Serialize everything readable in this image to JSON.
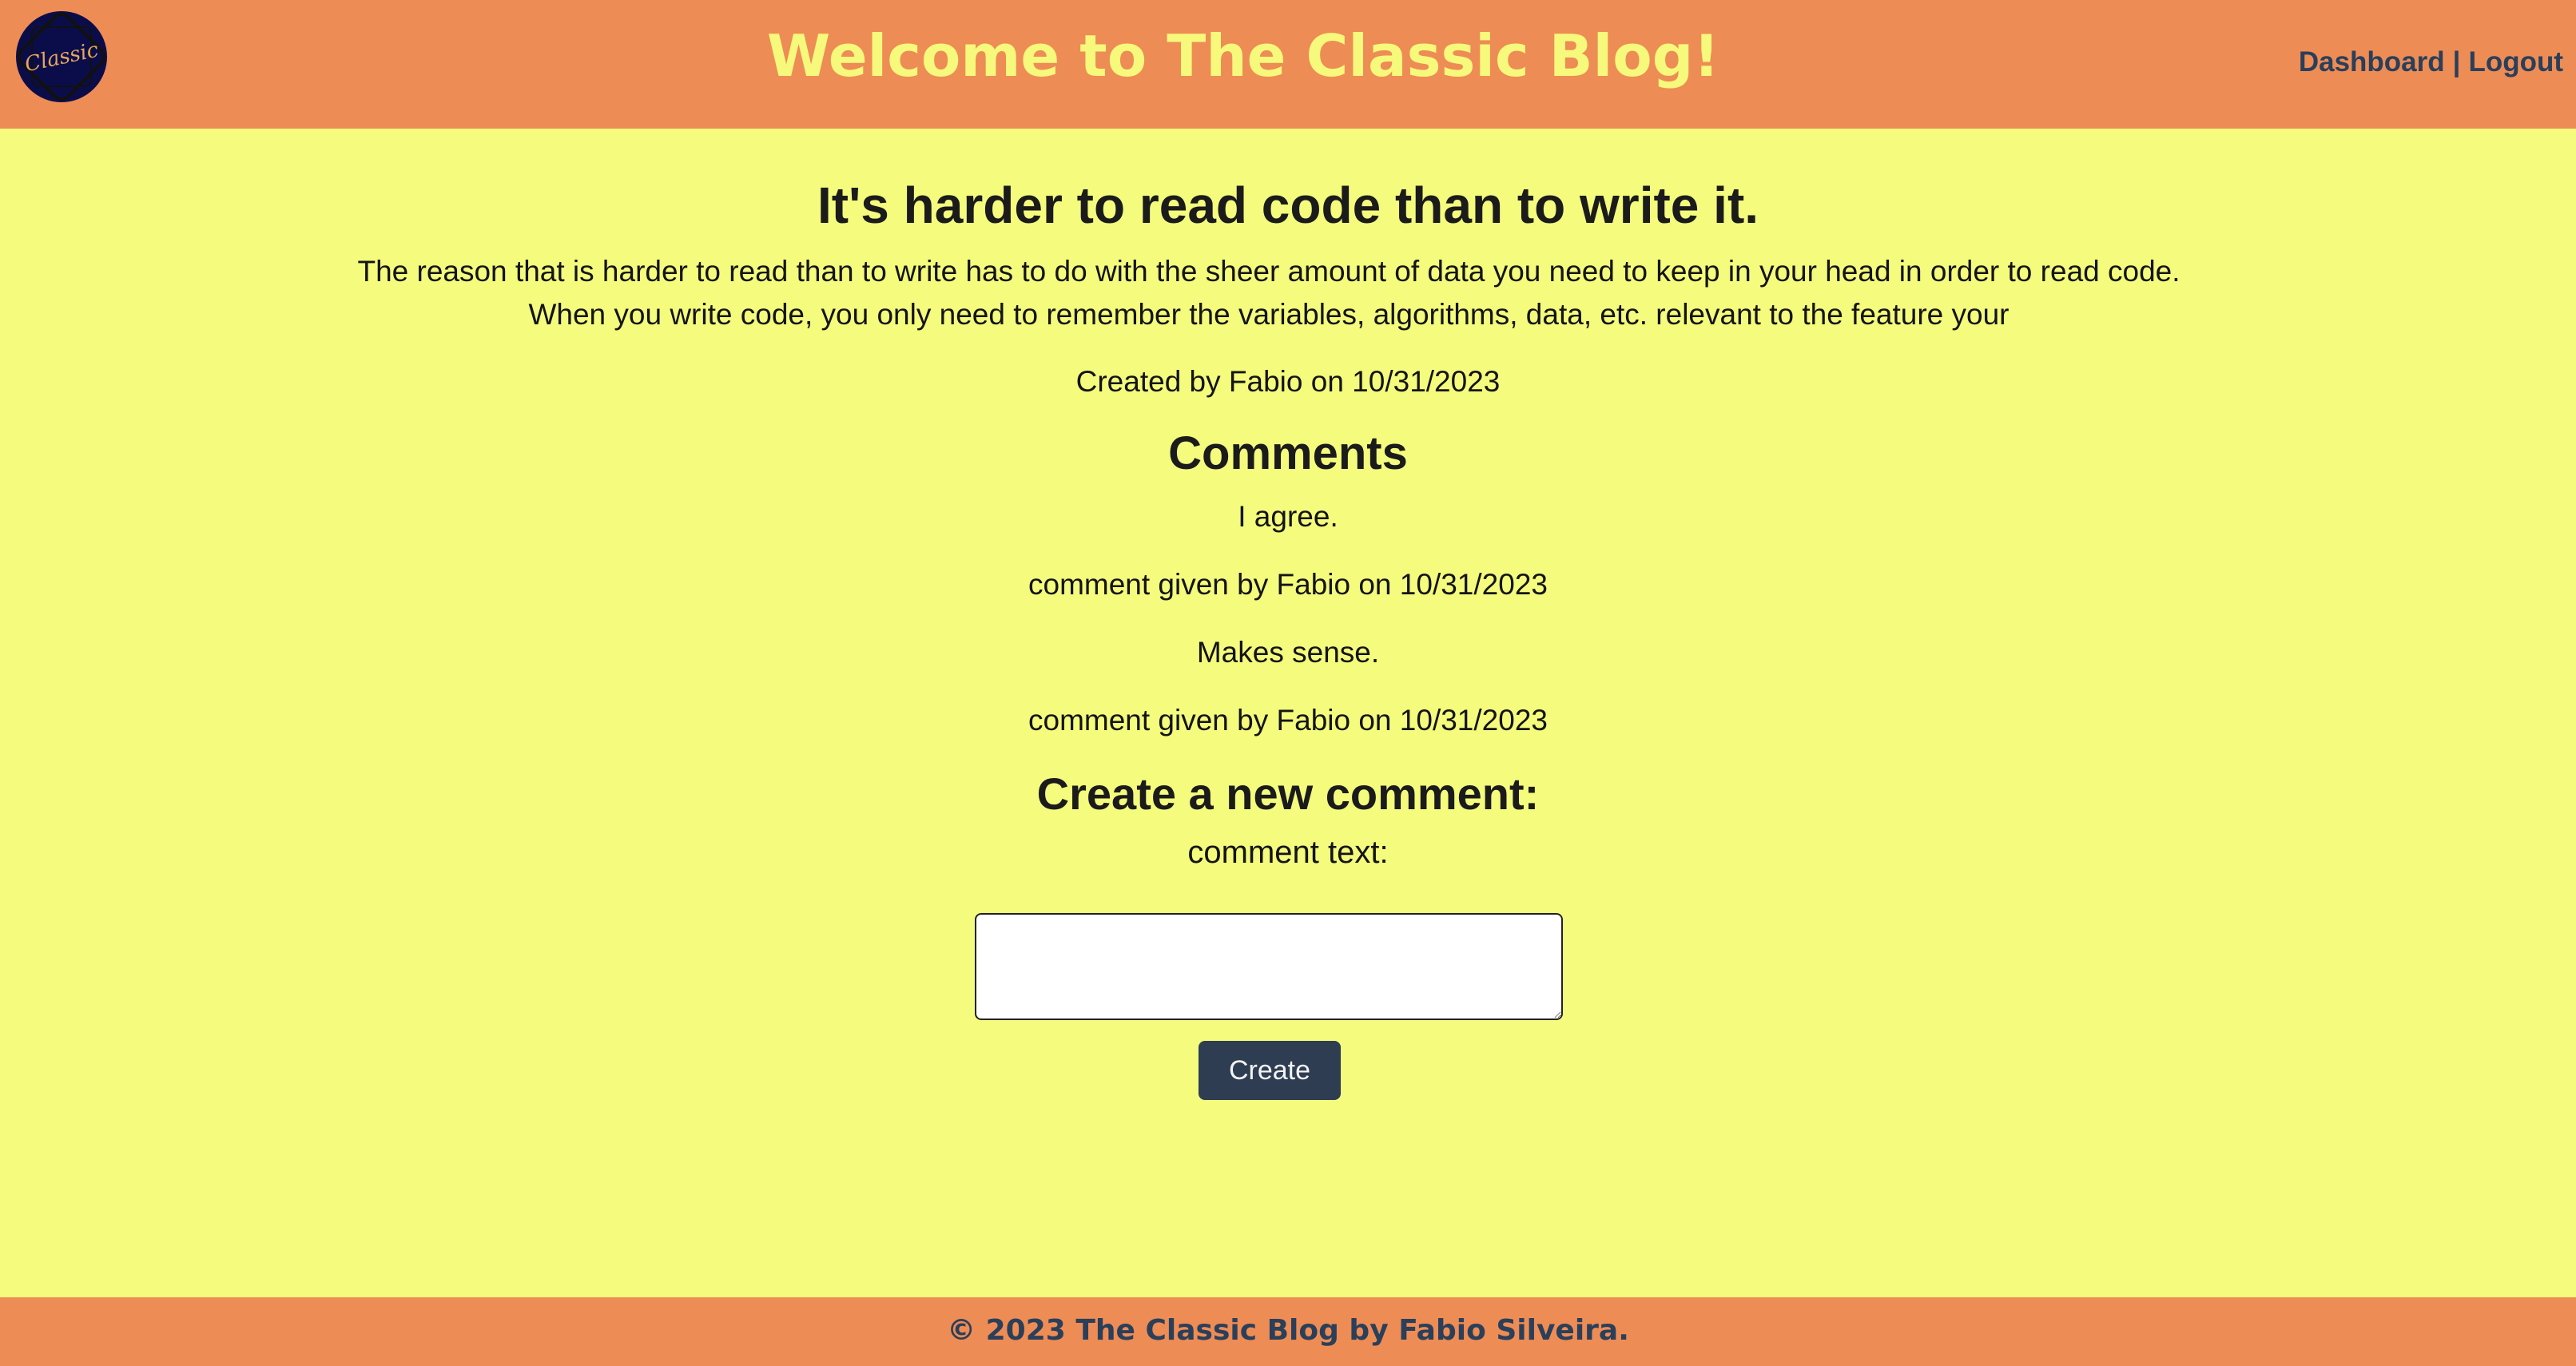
{
  "header": {
    "logo_text": "Classic",
    "title": "Welcome to The Classic Blog!",
    "nav": {
      "dashboard": "Dashboard",
      "separator": "|",
      "logout": "Logout"
    }
  },
  "post": {
    "title": "It's harder to read code than to write it.",
    "body": "The reason that is harder to read than to write has to do with the sheer amount of data you need to keep in your head in order to read code. When you write code, you only need to remember the variables, algorithms, data, etc. relevant to the feature your",
    "meta": "Created by Fabio on 10/31/2023"
  },
  "comments": {
    "heading": "Comments",
    "items": [
      {
        "text": "I agree.",
        "meta": "comment given by Fabio on 10/31/2023"
      },
      {
        "text": "Makes sense.",
        "meta": "comment given by Fabio on 10/31/2023"
      }
    ]
  },
  "new_comment": {
    "heading": "Create a new comment:",
    "label": "comment text:",
    "value": "",
    "button": "Create"
  },
  "footer": {
    "text": "© 2023 The Classic Blog by Fabio Silveira."
  },
  "colors": {
    "header_bg": "#ee8c55",
    "page_bg": "#f4fb7d",
    "title_text": "#f6f97b",
    "nav_text": "#2a3f5a",
    "button_bg": "#2e3d52",
    "logo_bg": "#0b0d4a",
    "logo_text": "#e6a65f"
  },
  "icons": {
    "logo": "classic-logo-badge"
  }
}
